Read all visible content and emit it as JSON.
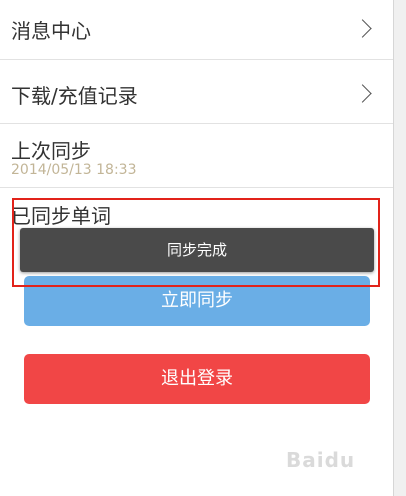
{
  "menu": {
    "message_center": "消息中心",
    "download_history": "下载/充值记录"
  },
  "last_sync": {
    "label": "上次同步",
    "timestamp": "2014/05/13 18:33"
  },
  "synced_words": {
    "label": "已同步单词"
  },
  "toast": {
    "message": "同步完成"
  },
  "buttons": {
    "sync_now": "立即同步",
    "logout": "退出登录"
  },
  "colors": {
    "sync_button": "#6aaee6",
    "logout_button": "#f14646",
    "highlight_box": "#e2231a"
  },
  "watermark": {
    "text": "Baidu"
  }
}
